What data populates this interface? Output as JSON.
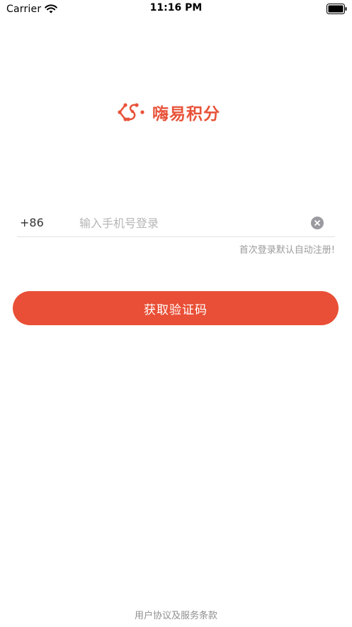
{
  "status_bar": {
    "carrier": "Carrier",
    "time": "11:16 PM",
    "icons": [
      "wifi-icon",
      "battery-icon"
    ]
  },
  "logo": {
    "text": "嗨易积分",
    "icon": "logo-icon",
    "color": "#e8533a"
  },
  "login": {
    "country_code": "+86",
    "phone_value": "",
    "phone_placeholder": "输入手机号登录",
    "clear_icon": "clear-icon",
    "register_hint": "首次登录默认自动注册!",
    "submit_label": "获取验证码",
    "accent_color": "#e94f36"
  },
  "footer": {
    "terms_label": "用户协议及服务条款"
  }
}
